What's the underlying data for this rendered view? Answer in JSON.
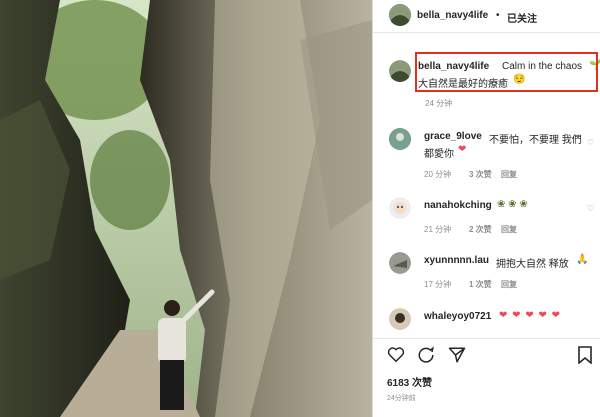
{
  "header": {
    "username": "bella_navy4life",
    "separator": "•",
    "follow_status": "已关注"
  },
  "caption": {
    "username": "bella_navy4life",
    "text_line1": "Calm in the chaos",
    "plant_emoji": "🌱",
    "text_line2": "大自然是最好的療癒",
    "smile_emoji": "😌",
    "time": "24 分钟"
  },
  "comments": [
    {
      "username": "grace_9love",
      "text": "不要怕，不要理 我們",
      "text2": "都愛你",
      "emoji": "❤",
      "time": "20 分钟",
      "likes": "3 次赞",
      "reply": "回复"
    },
    {
      "username": "nanahokching",
      "text": "",
      "text2": "",
      "emoji": "❀ ❀ ❀",
      "time": "21 分钟",
      "likes": "2 次赞",
      "reply": "回复"
    },
    {
      "username": "xyunnnnn.lau",
      "text": "拥抱大自然 释放",
      "text2": "",
      "emoji": "🙏",
      "time": "17 分钟",
      "likes": "1 次赞",
      "reply": "回复"
    },
    {
      "username": "whaleyoy0721",
      "text": "",
      "text2": "",
      "emoji": "❤ ❤ ❤ ❤ ❤",
      "time": "",
      "likes": "",
      "reply": ""
    }
  ],
  "actions": {
    "like_icon": "heart-outline-icon",
    "comment_icon": "comment-icon",
    "share_icon": "share-icon",
    "bookmark_icon": "bookmark-icon",
    "likes_count": "6183 次赞",
    "post_time": "24分钟前"
  },
  "colors": {
    "accent_red": "#e0301e",
    "heart_red": "#ed4956",
    "meta_gray": "#8e8e8e"
  }
}
